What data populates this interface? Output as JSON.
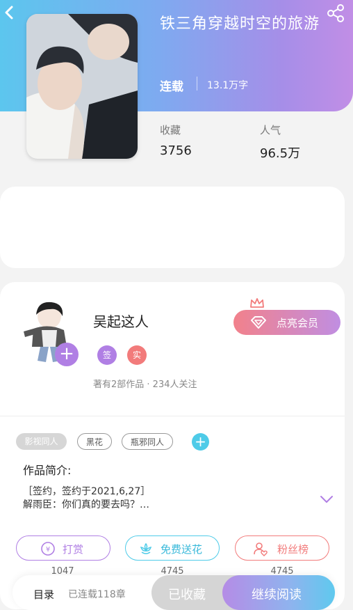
{
  "book": {
    "title": "铁三角穿越时空的旅游",
    "status": "连载",
    "word_count": "13.1万字",
    "stats": {
      "favorites_label": "收藏",
      "favorites_value": "3756",
      "popularity_label": "人气",
      "popularity_value": "96.5万"
    }
  },
  "author": {
    "name": "吴起这人",
    "badges": [
      "签",
      "实"
    ],
    "meta": "著有2部作品 · 234人关注",
    "vip_button": "点亮会员"
  },
  "tags": [
    "影视同人",
    "黑花",
    "瓶邪同人"
  ],
  "intro": {
    "title": "作品简介:",
    "line1": "［签约，签约于2021,6,27］",
    "line2": "解雨臣：你们真的要去吗？…"
  },
  "actions": [
    {
      "label": "打赏",
      "count": "1047"
    },
    {
      "label": "免费送花",
      "count": "4745"
    },
    {
      "label": "粉丝榜",
      "count": "4745"
    }
  ],
  "bottom_bar": {
    "toc": "目录",
    "chapters": "已连载118章",
    "collected": "已收藏",
    "read": "继续阅读"
  },
  "colors": {
    "header_start": "#5cc6ee",
    "header_end": "#c18ee6",
    "purple": "#b07fe4",
    "red": "#f27b7b",
    "cyan": "#4ecbe8"
  }
}
